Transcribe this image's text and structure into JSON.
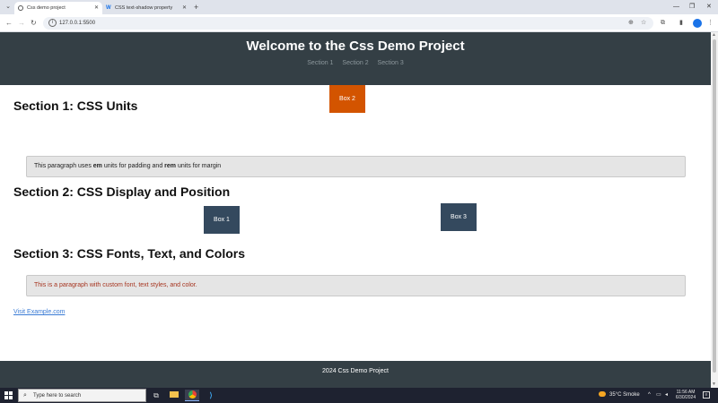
{
  "browser": {
    "tabs": [
      {
        "title": "Css demo project",
        "active": true
      },
      {
        "title": "CSS text-shadow property",
        "active": false
      }
    ],
    "url": "127.0.0.1:5500"
  },
  "site": {
    "title": "Welcome to the Css Demo Project",
    "nav": [
      "Section 1",
      "Section 2",
      "Section 3"
    ],
    "sections": [
      {
        "heading": "Section 1: CSS Units"
      },
      {
        "heading": "Section 2: CSS Display and Position"
      },
      {
        "heading": "Section 3: CSS Fonts, Text, and Colors"
      }
    ],
    "para1": {
      "pre": "This paragraph uses ",
      "em": "em",
      "mid": " units for padding and ",
      "rem": "rem",
      "post": " units for margin"
    },
    "para2": "This is a paragraph with custom font, text styles, and color.",
    "boxes": {
      "box1": "Box 1",
      "box2": "Box 2",
      "box3": "Box 3"
    },
    "link": "Visit Example.com",
    "footer": "2024 Css Demo Project"
  },
  "taskbar": {
    "search_placeholder": "Type here to search",
    "weather": "35°C  Smoke",
    "time": "11:56 AM",
    "date": "6/30/2024"
  },
  "colors": {
    "header_bg": "#343f45",
    "box2": "#d35400",
    "box_dark": "#34495e",
    "para_red": "#a6341f",
    "link": "#3a7bd5"
  }
}
